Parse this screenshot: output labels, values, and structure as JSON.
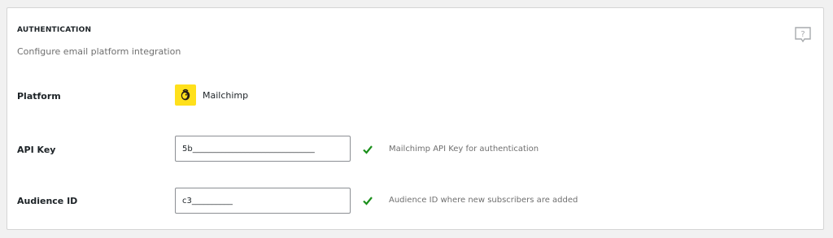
{
  "section": {
    "title": "AUTHENTICATION",
    "subtitle": "Configure email platform integration",
    "help_icon": "help-question-icon"
  },
  "platform": {
    "label": "Platform",
    "name": "Mailchimp",
    "icon": "mailchimp-logo",
    "logo_bg": "#ffe01b"
  },
  "api_key": {
    "label": "API Key",
    "value": "5b______________________________",
    "description": "Mailchimp API Key for authentication",
    "status_icon": "check-icon",
    "status_color": "#1a8f1a"
  },
  "audience_id": {
    "label": "Audience ID",
    "value": "c3__________",
    "description": "Audience ID where new subscribers are added",
    "status_icon": "check-icon",
    "status_color": "#1a8f1a"
  }
}
